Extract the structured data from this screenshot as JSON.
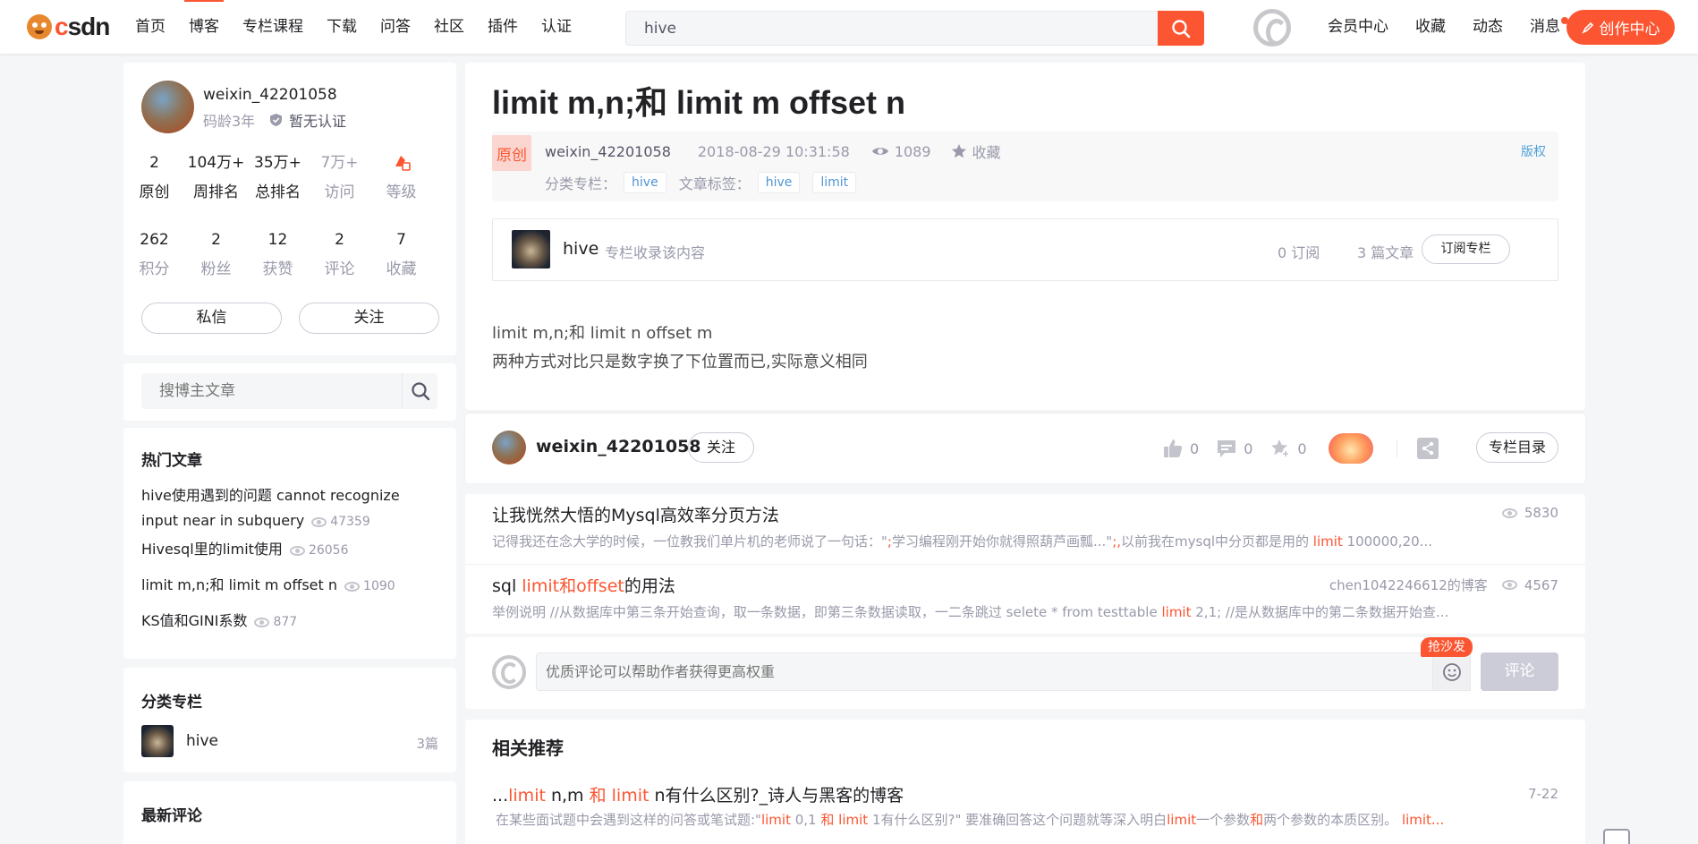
{
  "header": {
    "logo_text": "CSDN",
    "nav": [
      "首页",
      "博客",
      "专栏课程",
      "下载",
      "问答",
      "社区",
      "插件",
      "认证"
    ],
    "active_nav": "博客",
    "search_value": "hive",
    "links": [
      "会员中心",
      "收藏",
      "动态",
      "消息"
    ],
    "create_label": "创作中心",
    "accent": "#fc5531"
  },
  "profile": {
    "name": "weixin_42201058",
    "code_age": "码龄3年",
    "cert": "暂无认证",
    "stats_row1": [
      {
        "num": "2",
        "label": "原创"
      },
      {
        "num": "104万+",
        "label": "周排名"
      },
      {
        "num": "35万+",
        "label": "总排名"
      },
      {
        "num": "7万+",
        "label": "访问"
      },
      {
        "num": "",
        "label": "等级"
      }
    ],
    "stats_row2": [
      {
        "num": "262",
        "label": "积分"
      },
      {
        "num": "2",
        "label": "粉丝"
      },
      {
        "num": "12",
        "label": "获赞"
      },
      {
        "num": "2",
        "label": "评论"
      },
      {
        "num": "7",
        "label": "收藏"
      }
    ],
    "message_label": "私信",
    "follow_label": "关注"
  },
  "side_search": {
    "placeholder": "搜博主文章"
  },
  "hot": {
    "title": "热门文章",
    "items": [
      {
        "title": "hive使用遇到的问题 cannot recognize input near in subquery",
        "views": "47359"
      },
      {
        "title": "Hivesql里的limit使用",
        "views": "26056"
      },
      {
        "title": "limit m,n;和 limit m offset n",
        "views": "1090"
      },
      {
        "title": "KS值和GINI系数",
        "views": "877"
      }
    ]
  },
  "columns": {
    "title": "分类专栏",
    "items": [
      {
        "name": "hive",
        "count": "3篇"
      }
    ]
  },
  "latest_comments": {
    "title": "最新评论"
  },
  "article": {
    "title": "limit m,n;和 limit m offset n",
    "badge": "原创",
    "author": "weixin_42201058",
    "date": "2018-08-29 10:31:58",
    "reads": "1089",
    "fav_label": "收藏",
    "copyright": "版权",
    "category_label": "分类专栏：",
    "category_tag": "hive",
    "tags_label": "文章标签：",
    "tags": [
      "hive",
      "limit"
    ],
    "column_box": {
      "name": "hive",
      "desc": "专栏收录该内容",
      "subs": "0 订阅",
      "articles": "3 篇文章",
      "button": "订阅专栏"
    },
    "body": [
      "limit m,n;和 limit n offset m",
      "两种方式对比只是数字换了下位置而已,实际意义相同"
    ]
  },
  "toolbar": {
    "author": "weixin_42201058",
    "follow": "关注",
    "likes": "0",
    "comments": "0",
    "favs": "0",
    "directory": "专栏目录"
  },
  "recommend": [
    {
      "title": "让我恍然大悟的Mysql高效率分页方法",
      "author": "",
      "views": "5830",
      "desc_pre": "记得我还在念大学的时候，一位教我们单片机的老师说了一句话：\"",
      "desc_hl1": ";",
      "desc_mid": "学习编程刚开始你就得照葫芦画瓢...\"",
      "desc_hl2": ";,",
      "desc_mid2": "以前我在mysql中分页都是用的 ",
      "desc_hl3": "limit",
      "desc_post": " 100000,20..."
    },
    {
      "title_pre": "sql ",
      "title_hl": "limit和offset",
      "title_post": "的用法",
      "author": "chen1042246612的博客",
      "views": "4567",
      "desc_pre": "举例说明 //从数据库中第三条开始查询，取一条数据，即第三条数据读取，一二条跳过 selete * from testtable ",
      "desc_hl": "limit",
      "desc_post": " 2,1; //是从数据库中的第二条数据开始查..."
    }
  ],
  "comment_box": {
    "placeholder": "优质评论可以帮助作者获得更高权重",
    "sofa": "抢沙发",
    "submit": "评论"
  },
  "related": {
    "title": "相关推荐",
    "item": {
      "t1": "...",
      "t2": "limit",
      "t3": " n,m ",
      "t4": "和",
      "t5": " ",
      "t6": "limit",
      "t7": " n有什么区别?_诗人与黑客的博客",
      "date": "7-22",
      "d1": "在某些面试题中会遇到这样的问答或笔试题:\"",
      "d2": "limit",
      "d3": " 0,1 ",
      "d4": "和",
      "d5": " ",
      "d6": "limit",
      "d7": " 1有什么区别?\" 要准确回答这个问题就等深入明白",
      "d8": "limit",
      "d9": "一个参数",
      "d10": "和",
      "d11": "两个参数的本质区别。 ",
      "d12": "limit..."
    }
  }
}
